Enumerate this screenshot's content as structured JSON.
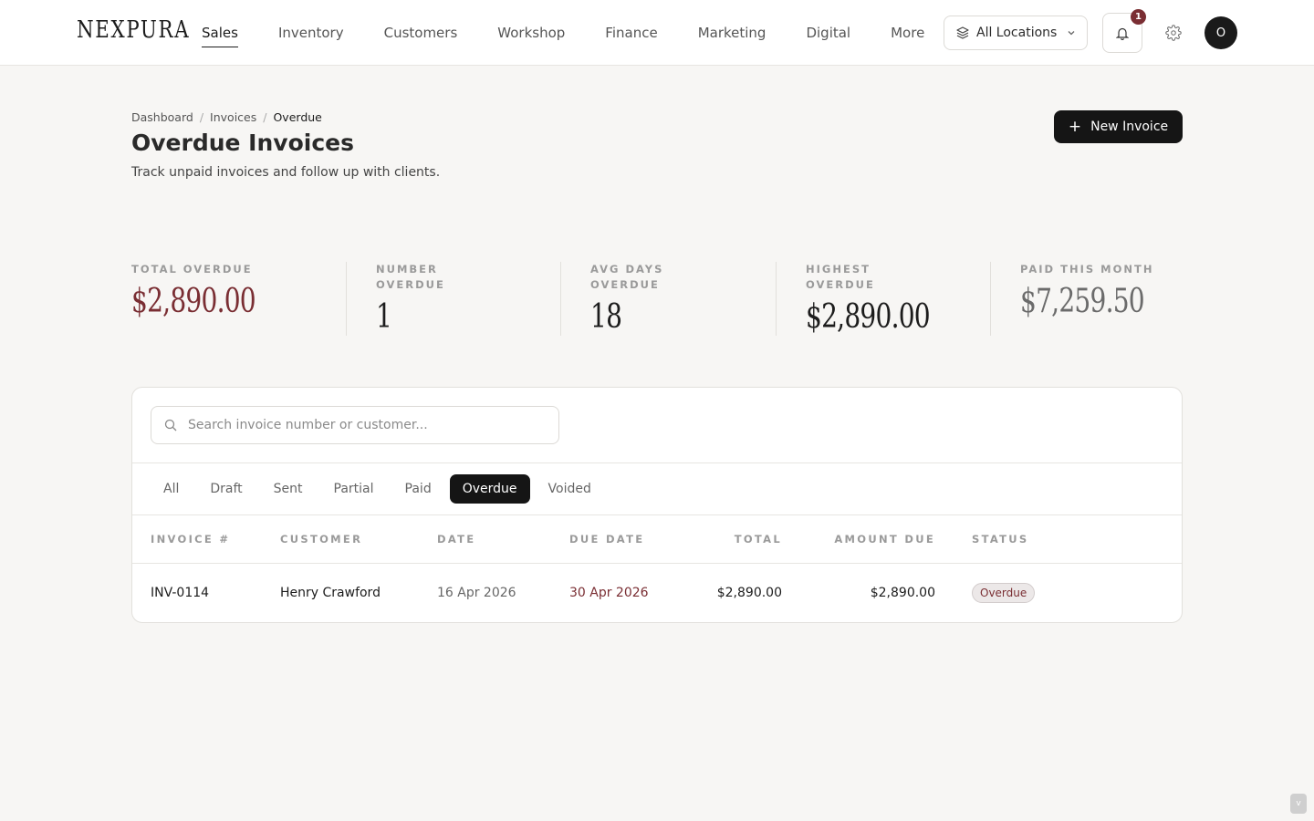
{
  "brand": {
    "logo": "NEXPURA"
  },
  "nav": {
    "items": [
      {
        "label": "Sales",
        "active": true
      },
      {
        "label": "Inventory",
        "active": false
      },
      {
        "label": "Customers",
        "active": false
      },
      {
        "label": "Workshop",
        "active": false
      },
      {
        "label": "Finance",
        "active": false
      },
      {
        "label": "Marketing",
        "active": false
      },
      {
        "label": "Digital",
        "active": false
      },
      {
        "label": "More",
        "active": false
      }
    ],
    "location_label": "All Locations",
    "location_icon": "layers-icon",
    "notification_count": "1",
    "avatar_initial": "O"
  },
  "breadcrumb": [
    "Dashboard",
    "Invoices",
    "Overdue"
  ],
  "header": {
    "title": "Overdue Invoices",
    "subtitle": "Track unpaid invoices and follow up with clients.",
    "new_button": "New Invoice"
  },
  "stats": [
    {
      "label": "Total Overdue",
      "value": "$2,890.00",
      "color": "#7a2e33"
    },
    {
      "label": "Number Overdue",
      "value": "1",
      "color": "#1c1c1c"
    },
    {
      "label": "Avg Days Overdue",
      "value": "18",
      "color": "#1c1c1c"
    },
    {
      "label": "Highest Overdue",
      "value": "$2,890.00",
      "color": "#1c1c1c"
    },
    {
      "label": "Paid This Month",
      "value": "$7,259.50",
      "color": "#6b6b6b"
    }
  ],
  "search": {
    "placeholder": "Search invoice number or customer..."
  },
  "tabs": [
    {
      "label": "All",
      "active": false
    },
    {
      "label": "Draft",
      "active": false
    },
    {
      "label": "Sent",
      "active": false
    },
    {
      "label": "Partial",
      "active": false
    },
    {
      "label": "Paid",
      "active": false
    },
    {
      "label": "Overdue",
      "active": true
    },
    {
      "label": "Voided",
      "active": false
    }
  ],
  "table": {
    "columns": [
      "Invoice #",
      "Customer",
      "Date",
      "Due Date",
      "Total",
      "Amount Due",
      "Status"
    ],
    "rows": [
      {
        "invoice": "INV-0114",
        "customer": "Henry Crawford",
        "date": "16 Apr 2026",
        "due_date": "30 Apr 2026",
        "total": "$2,890.00",
        "amount_due": "$2,890.00",
        "status": "Overdue"
      }
    ]
  },
  "colors": {
    "accent": "#151515",
    "overdue": "#7a2e33"
  },
  "corner_button": "v"
}
